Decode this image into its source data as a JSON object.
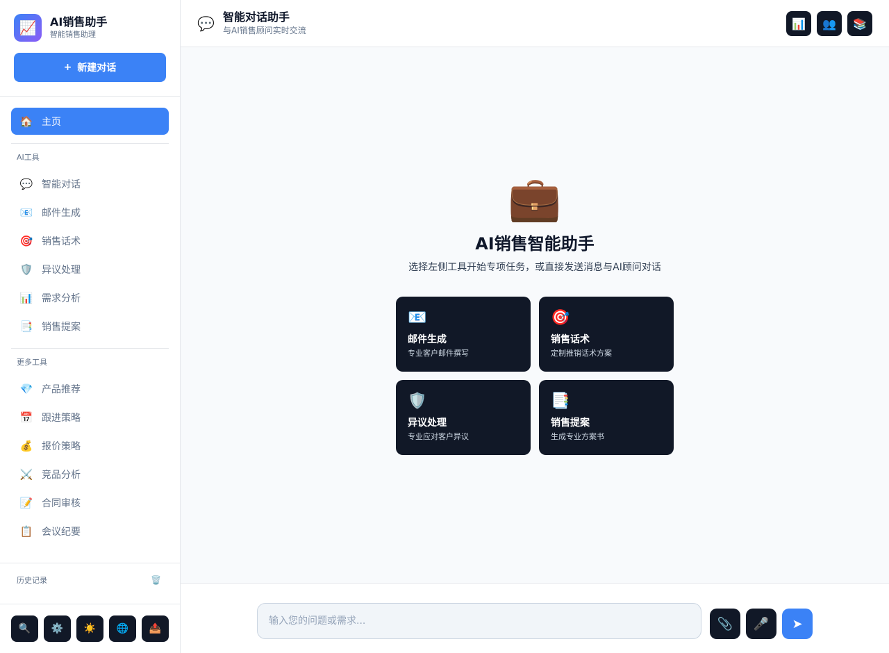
{
  "app": {
    "logo_icon": "📈",
    "title": "AI销售助手",
    "subtitle": "智能销售助理",
    "new_chat": {
      "icon": "+",
      "label": "新建对话"
    }
  },
  "nav": {
    "home": {
      "icon": "🏠",
      "label": "主页"
    },
    "ai_tools_title": "AI工具",
    "ai_tools": [
      {
        "icon": "💬",
        "label": "智能对话"
      },
      {
        "icon": "📧",
        "label": "邮件生成"
      },
      {
        "icon": "🎯",
        "label": "销售话术"
      },
      {
        "icon": "🛡️",
        "label": "异议处理"
      },
      {
        "icon": "📊",
        "label": "需求分析"
      },
      {
        "icon": "📑",
        "label": "销售提案"
      }
    ],
    "more_tools_title": "更多工具",
    "more_tools": [
      {
        "icon": "💎",
        "label": "产品推荐"
      },
      {
        "icon": "📅",
        "label": "跟进策略"
      },
      {
        "icon": "💰",
        "label": "报价策略"
      },
      {
        "icon": "⚔️",
        "label": "竞品分析"
      },
      {
        "icon": "📝",
        "label": "合同审核"
      },
      {
        "icon": "📋",
        "label": "会议纪要"
      }
    ]
  },
  "history": {
    "label": "历史记录",
    "trash_icon": "🗑️"
  },
  "bottom_tools": [
    {
      "name": "search-icon",
      "icon": "🔍"
    },
    {
      "name": "gear-icon",
      "icon": "⚙️"
    },
    {
      "name": "sun-icon",
      "icon": "☀️"
    },
    {
      "name": "globe-icon",
      "icon": "🌐"
    },
    {
      "name": "export-icon",
      "icon": "📤"
    }
  ],
  "header": {
    "icon": "💬",
    "title": "智能对话助手",
    "subtitle": "与AI销售顾问实时交流",
    "actions": [
      {
        "name": "stats-icon",
        "icon": "📊"
      },
      {
        "name": "users-icon",
        "icon": "👥"
      },
      {
        "name": "books-icon",
        "icon": "📚"
      }
    ]
  },
  "welcome": {
    "icon": "💼",
    "title": "AI销售智能助手",
    "subtitle": "选择左侧工具开始专项任务，或直接发送消息与AI顾问对话",
    "cards": [
      {
        "icon": "📧",
        "title": "邮件生成",
        "desc": "专业客户邮件撰写"
      },
      {
        "icon": "🎯",
        "title": "销售话术",
        "desc": "定制推销话术方案"
      },
      {
        "icon": "🛡️",
        "title": "异议处理",
        "desc": "专业应对客户异议"
      },
      {
        "icon": "📑",
        "title": "销售提案",
        "desc": "生成专业方案书"
      }
    ]
  },
  "composer": {
    "placeholder": "输入您的问题或需求...",
    "attach_icon": "📎",
    "mic_icon": "🎤",
    "send_icon": "➤"
  },
  "colors": {
    "accent": "#3b82f6",
    "dark_button": "#111827",
    "border": "#e5e7eb",
    "muted_text": "#64748b"
  }
}
